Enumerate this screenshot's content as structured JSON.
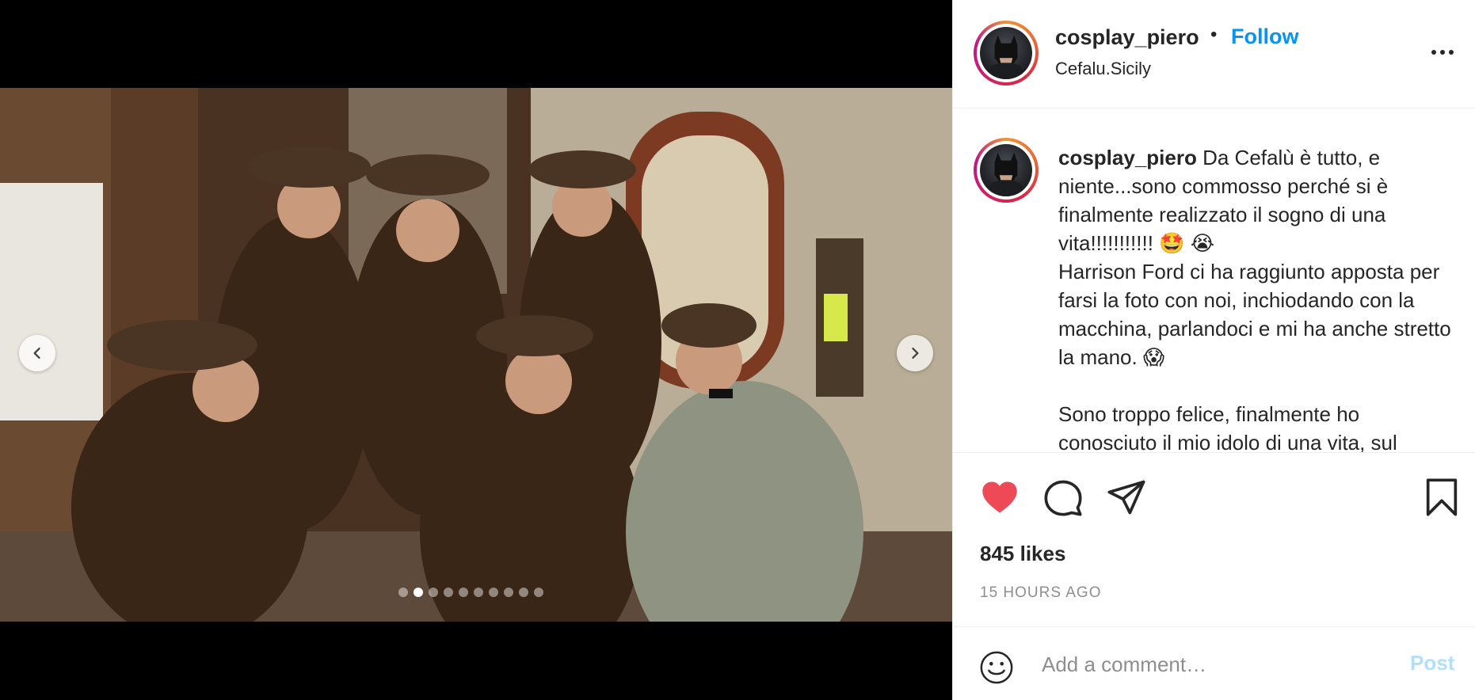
{
  "post": {
    "media": {
      "description_icon": "photo",
      "carousel": {
        "total_slides": 10,
        "active_index": 1
      }
    },
    "header": {
      "username": "cosplay_piero",
      "separator": "•",
      "follow_label": "Follow",
      "location": "Cefalu.Sicily"
    },
    "caption": {
      "username": "cosplay_piero",
      "text": " Da Cefalù è tutto, e niente...sono commosso perché si è finalmente realizzato il sogno di una vita!!!!!!!!!!! 🤩 😭\nHarrison Ford ci ha raggiunto apposta per farsi la foto con noi, inchiodando con la macchina, parlandoci e mi ha anche stretto la mano. 😱\n\nSono troppo felice, finalmente ho conosciuto il mio idolo di una vita, sul"
    },
    "actions": {
      "liked": true,
      "like_color": "#ed4956",
      "likes_text": "845 likes",
      "time_text": "15 HOURS AGO"
    },
    "comment_bar": {
      "placeholder": "Add a comment…",
      "post_label": "Post"
    }
  }
}
